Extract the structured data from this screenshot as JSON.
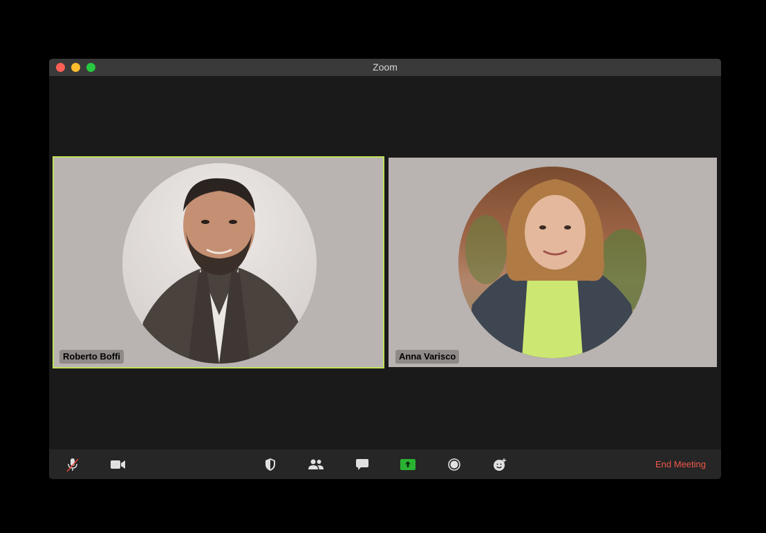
{
  "window": {
    "title": "Zoom"
  },
  "participants": [
    {
      "name": "Roberto Boffi",
      "active_speaker": true
    },
    {
      "name": "Anna Varisco",
      "active_speaker": false
    }
  ],
  "toolbar": {
    "buttons": [
      {
        "icon": "microphone-muted-icon"
      },
      {
        "icon": "video-camera-icon"
      },
      {
        "icon": "security-shield-icon"
      },
      {
        "icon": "participants-icon"
      },
      {
        "icon": "chat-icon"
      },
      {
        "icon": "share-screen-icon"
      },
      {
        "icon": "record-icon"
      },
      {
        "icon": "reactions-icon"
      }
    ],
    "end_meeting_label": "End Meeting"
  },
  "colors": {
    "active_speaker_border": "#bfe35a",
    "share_screen_green": "#2ab332",
    "end_meeting_red": "#f0574a"
  }
}
